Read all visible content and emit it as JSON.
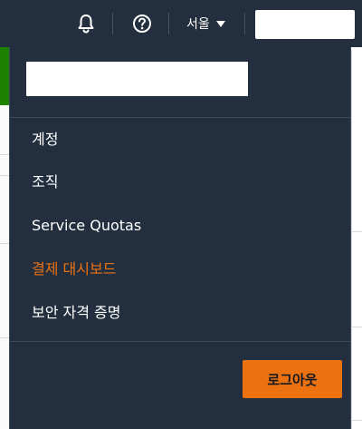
{
  "topbar": {
    "region_label": "서울",
    "bell_icon": "bell-icon",
    "help_icon": "help-circle-icon",
    "caret_icon": "caret-down-icon"
  },
  "menu": {
    "items": [
      {
        "label": "계정"
      },
      {
        "label": "조직"
      },
      {
        "label": "Service Quotas"
      },
      {
        "label": "결제 대시보드"
      },
      {
        "label": "보안 자격 증명"
      }
    ],
    "active_item": "결제 대시보드",
    "logout_label": "로그아웃"
  },
  "colors": {
    "navbar": "#232f3e",
    "accent": "#ec7211",
    "success": "#1d8102"
  }
}
